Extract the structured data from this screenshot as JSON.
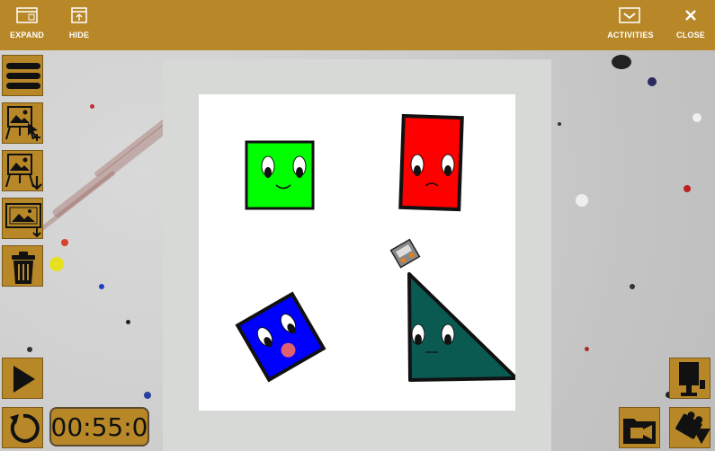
{
  "topbar": {
    "expand_label": "EXPAND",
    "hide_label": "HIDE",
    "activities_label": "ACTIVITIES",
    "close_label": "CLOSE",
    "color": "#b88828"
  },
  "toolbar": {
    "icons": [
      "menu-icon",
      "add-background-icon",
      "download-background-icon",
      "background-settings-icon",
      "trash-icon"
    ]
  },
  "playback": {
    "timer": "00:55:0",
    "icons": [
      "play-icon",
      "replay-icon"
    ]
  },
  "right_tools": {
    "icons": [
      "record-icon",
      "folder-video-icon",
      "camera-icon"
    ]
  },
  "characters": [
    {
      "name": "green-square",
      "color": "#00ff00",
      "mood": "happy"
    },
    {
      "name": "red-rectangle",
      "color": "#ff0000",
      "mood": "sad"
    },
    {
      "name": "blue-square",
      "color": "#0000ff",
      "mood": "surprised"
    },
    {
      "name": "teal-triangle",
      "color": "#0a5a52",
      "mood": "neutral"
    }
  ]
}
